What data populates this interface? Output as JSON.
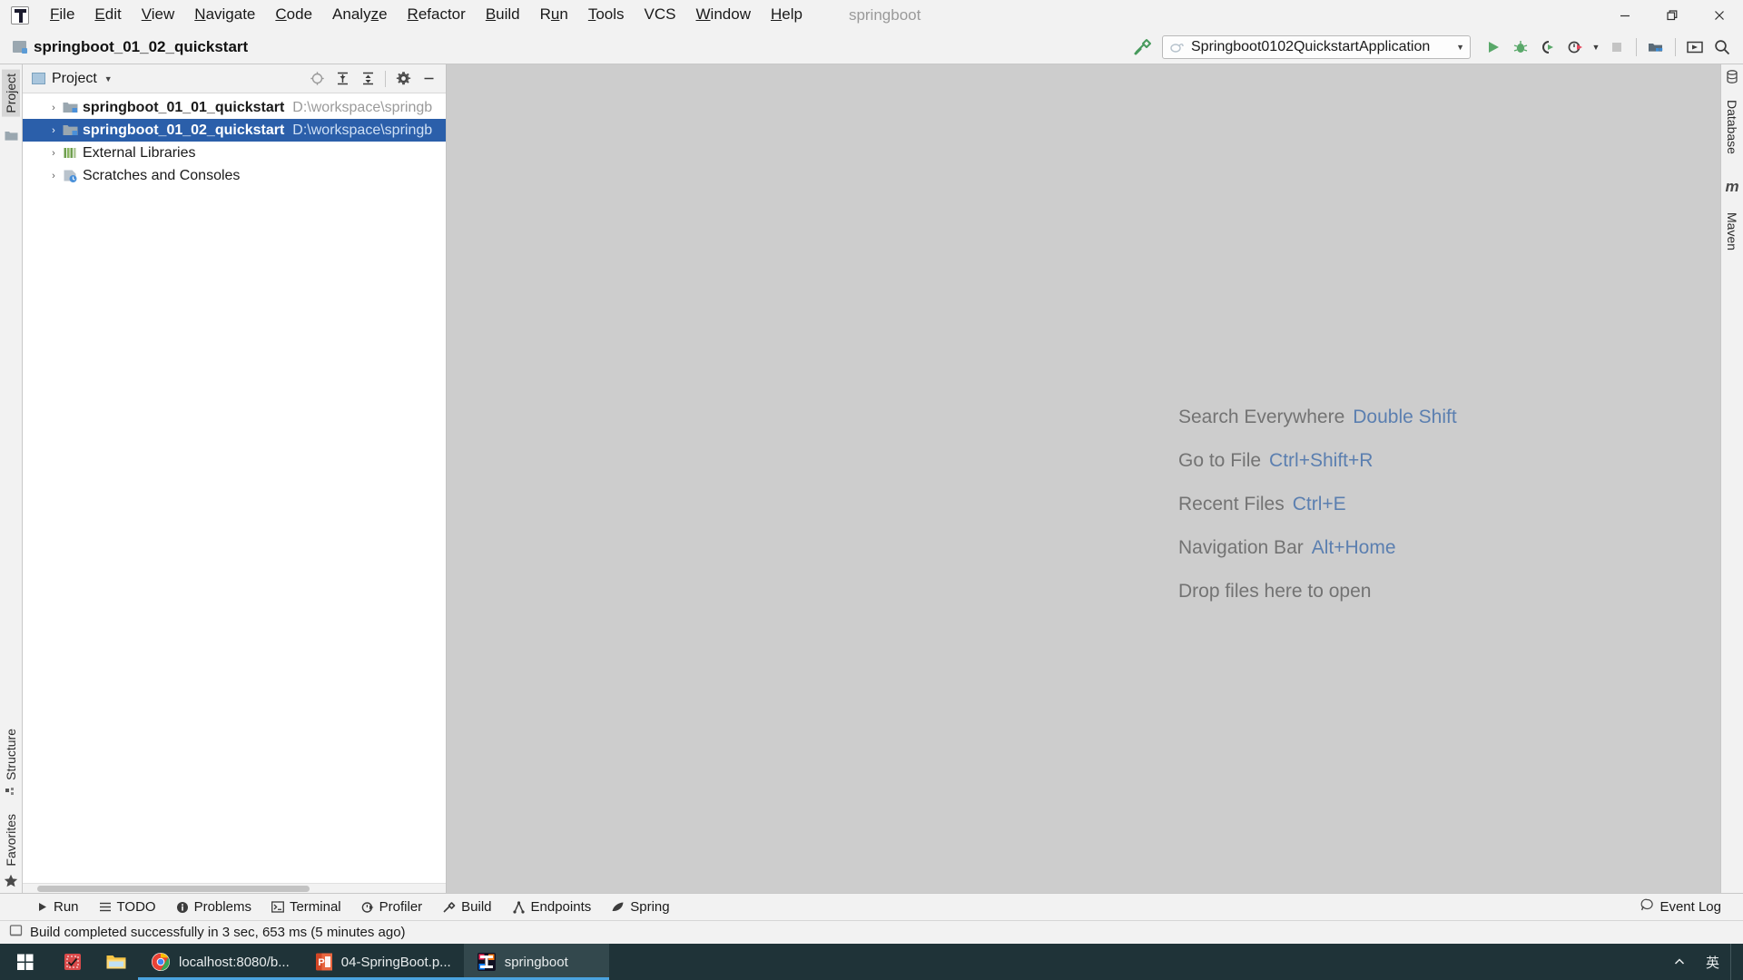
{
  "window": {
    "title": "springboot",
    "controls": {
      "minimize": "—",
      "maximize": "❐",
      "close": "✕"
    }
  },
  "menubar": {
    "logo_icon": "intellij-idea-logo-icon",
    "items": [
      {
        "label": "File",
        "mnemonic": "F"
      },
      {
        "label": "Edit",
        "mnemonic": "E"
      },
      {
        "label": "View",
        "mnemonic": "V"
      },
      {
        "label": "Navigate",
        "mnemonic": "N"
      },
      {
        "label": "Code",
        "mnemonic": "C"
      },
      {
        "label": "Analyze",
        "mnemonic": "z"
      },
      {
        "label": "Refactor",
        "mnemonic": "R"
      },
      {
        "label": "Build",
        "mnemonic": "B"
      },
      {
        "label": "Run",
        "mnemonic": "u"
      },
      {
        "label": "Tools",
        "mnemonic": "T"
      },
      {
        "label": "VCS",
        "mnemonic": ""
      },
      {
        "label": "Window",
        "mnemonic": "W"
      },
      {
        "label": "Help",
        "mnemonic": "H"
      }
    ]
  },
  "navbar": {
    "breadcrumb": "springboot_01_02_quickstart",
    "build_icon": "hammer-icon",
    "run_config": {
      "icon": "spring-boot-run-config-icon",
      "label": "Springboot0102QuickstartApplication",
      "dropdown_arrow": "▼"
    },
    "buttons": [
      {
        "name": "run-button",
        "icon": "play-icon"
      },
      {
        "name": "debug-button",
        "icon": "bug-icon"
      },
      {
        "name": "run-with-coverage-button",
        "icon": "coverage-icon"
      },
      {
        "name": "profiler-button",
        "icon": "profiler-clock-icon"
      },
      {
        "name": "profiler-dropdown",
        "icon": "chevron-down-icon"
      },
      {
        "name": "stop-button",
        "icon": "stop-square-icon"
      },
      {
        "name": "project-structure-button",
        "icon": "project-structure-icon"
      },
      {
        "name": "layout-button",
        "icon": "layout-icon"
      },
      {
        "name": "search-button",
        "icon": "search-icon"
      }
    ]
  },
  "left_stripe": {
    "top": [
      {
        "label": "Project",
        "icon": "project-folder-icon",
        "active": true
      }
    ],
    "bottom": [
      {
        "label": "Structure",
        "icon": "structure-icon"
      },
      {
        "label": "Favorites",
        "icon": "star-icon"
      }
    ]
  },
  "right_stripe": [
    {
      "label": "Database",
      "icon": "database-icon"
    },
    {
      "label": "Maven",
      "icon": "maven-m-icon"
    }
  ],
  "project_panel": {
    "title": "Project",
    "title_icon": "project-window-icon",
    "dropdown_arrow": "▼",
    "actions": [
      {
        "name": "select-opened-file-button",
        "icon": "crosshair-target-icon"
      },
      {
        "name": "expand-all-button",
        "icon": "expand-all-icon"
      },
      {
        "name": "collapse-all-button",
        "icon": "collapse-all-icon"
      },
      {
        "name": "settings-button",
        "icon": "gear-icon"
      },
      {
        "name": "hide-button",
        "icon": "minimize-icon"
      }
    ],
    "tree": [
      {
        "name": "springboot_01_01_quickstart",
        "path": "D:\\workspace\\springb",
        "icon": "module-folder-icon",
        "arrow": "›",
        "bold": true,
        "selected": false
      },
      {
        "name": "springboot_01_02_quickstart",
        "path": "D:\\workspace\\springb",
        "icon": "module-folder-icon",
        "arrow": "›",
        "bold": true,
        "selected": true
      },
      {
        "name": "External Libraries",
        "path": "",
        "icon": "libraries-icon",
        "arrow": "›",
        "bold": false,
        "selected": false
      },
      {
        "name": "Scratches and Consoles",
        "path": "",
        "icon": "scratches-icon",
        "arrow": "›",
        "bold": false,
        "selected": false
      }
    ]
  },
  "editor": {
    "hints": [
      {
        "label": "Search Everywhere",
        "key": "Double Shift"
      },
      {
        "label": "Go to File",
        "key": "Ctrl+Shift+R"
      },
      {
        "label": "Recent Files",
        "key": "Ctrl+E"
      },
      {
        "label": "Navigation Bar",
        "key": "Alt+Home"
      },
      {
        "label": "Drop files here to open",
        "key": ""
      }
    ]
  },
  "bottom_toolwindows": [
    {
      "label": "Run",
      "icon": "play-icon"
    },
    {
      "label": "TODO",
      "icon": "todo-list-icon"
    },
    {
      "label": "Problems",
      "icon": "problems-info-icon"
    },
    {
      "label": "Terminal",
      "icon": "terminal-icon"
    },
    {
      "label": "Profiler",
      "icon": "profiler-clock-icon"
    },
    {
      "label": "Build",
      "icon": "hammer-icon"
    },
    {
      "label": "Endpoints",
      "icon": "endpoints-icon"
    },
    {
      "label": "Spring",
      "icon": "spring-leaf-icon"
    }
  ],
  "event_log": {
    "label": "Event Log",
    "icon": "event-log-icon"
  },
  "statusbar": {
    "icon": "build-status-icon",
    "text": "Build completed successfully in 3 sec, 653 ms (5 minutes ago)"
  },
  "taskbar": {
    "start": {
      "icon": "windows-start-icon"
    },
    "pinned": [
      {
        "name": "antivirus-icon",
        "icon": "red-shield-icon"
      },
      {
        "name": "file-explorer-icon",
        "icon": "folder-icon"
      }
    ],
    "tasks": [
      {
        "label": "localhost:8080/b...",
        "icon": "chrome-icon",
        "active": false
      },
      {
        "label": "04-SpringBoot.p...",
        "icon": "powerpoint-icon",
        "active": false
      },
      {
        "label": "springboot",
        "icon": "intellij-idea-icon",
        "active": true
      }
    ],
    "tray": [
      {
        "name": "show-hidden-icons",
        "icon": "chevron-up-icon",
        "label": "⌃"
      },
      {
        "name": "ime-language-indicator",
        "icon": "ime-icon",
        "label": "英"
      }
    ]
  },
  "colors": {
    "accent_blue": "#2b5faa",
    "hint_key_blue": "#5b7fb0",
    "taskbar_bg": "#1f3338",
    "panel_bg": "#f2f2f2",
    "editor_bg": "#cdcdcd"
  }
}
